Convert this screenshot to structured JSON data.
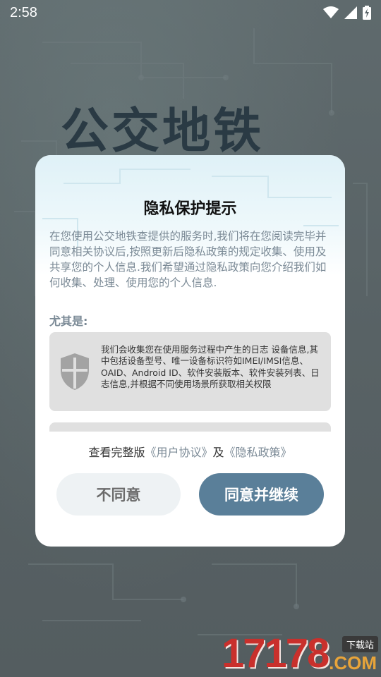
{
  "status_bar": {
    "time": "2:58",
    "icons": [
      "wifi-icon",
      "signal-icon",
      "battery-charging-icon"
    ]
  },
  "background": {
    "app_title": "公交地铁"
  },
  "dialog": {
    "title": "隐私保护提示",
    "body": "在您使用公交地铁查提供的服务时,我们将在您阅读完毕并同意相关协议后,按照更新后隐私政策的规定收集、使用及共享您的个人信息.我们希望通过隐私政策向您介绍我们如何收集、处理、使用您的个人信息.",
    "especially_label": "尤其是:",
    "cards": [
      {
        "icon": "shield-icon",
        "text": "我们会收集您在使用服务过程中产生的日志 设备信息,其中包括设备型号、唯一设备标识符如IMEI/IMSI信息、OAID、Android ID、软件安装版本、软件安装列表、日志信息,并根据不同使用场景所获取相关权限"
      }
    ],
    "links": {
      "prefix": "查看完整版",
      "user_agreement": "《用户协议》",
      "and": "及",
      "privacy_policy": "《隐私政策》"
    },
    "buttons": {
      "disagree": "不同意",
      "agree": "同意并继续"
    }
  },
  "watermark": {
    "number": "17178",
    "domain": ".COM",
    "tag": "下载站"
  },
  "colors": {
    "accent": "#5a7f99",
    "muted_text": "#7b8a96",
    "card_bg": "#e0e0e0"
  }
}
